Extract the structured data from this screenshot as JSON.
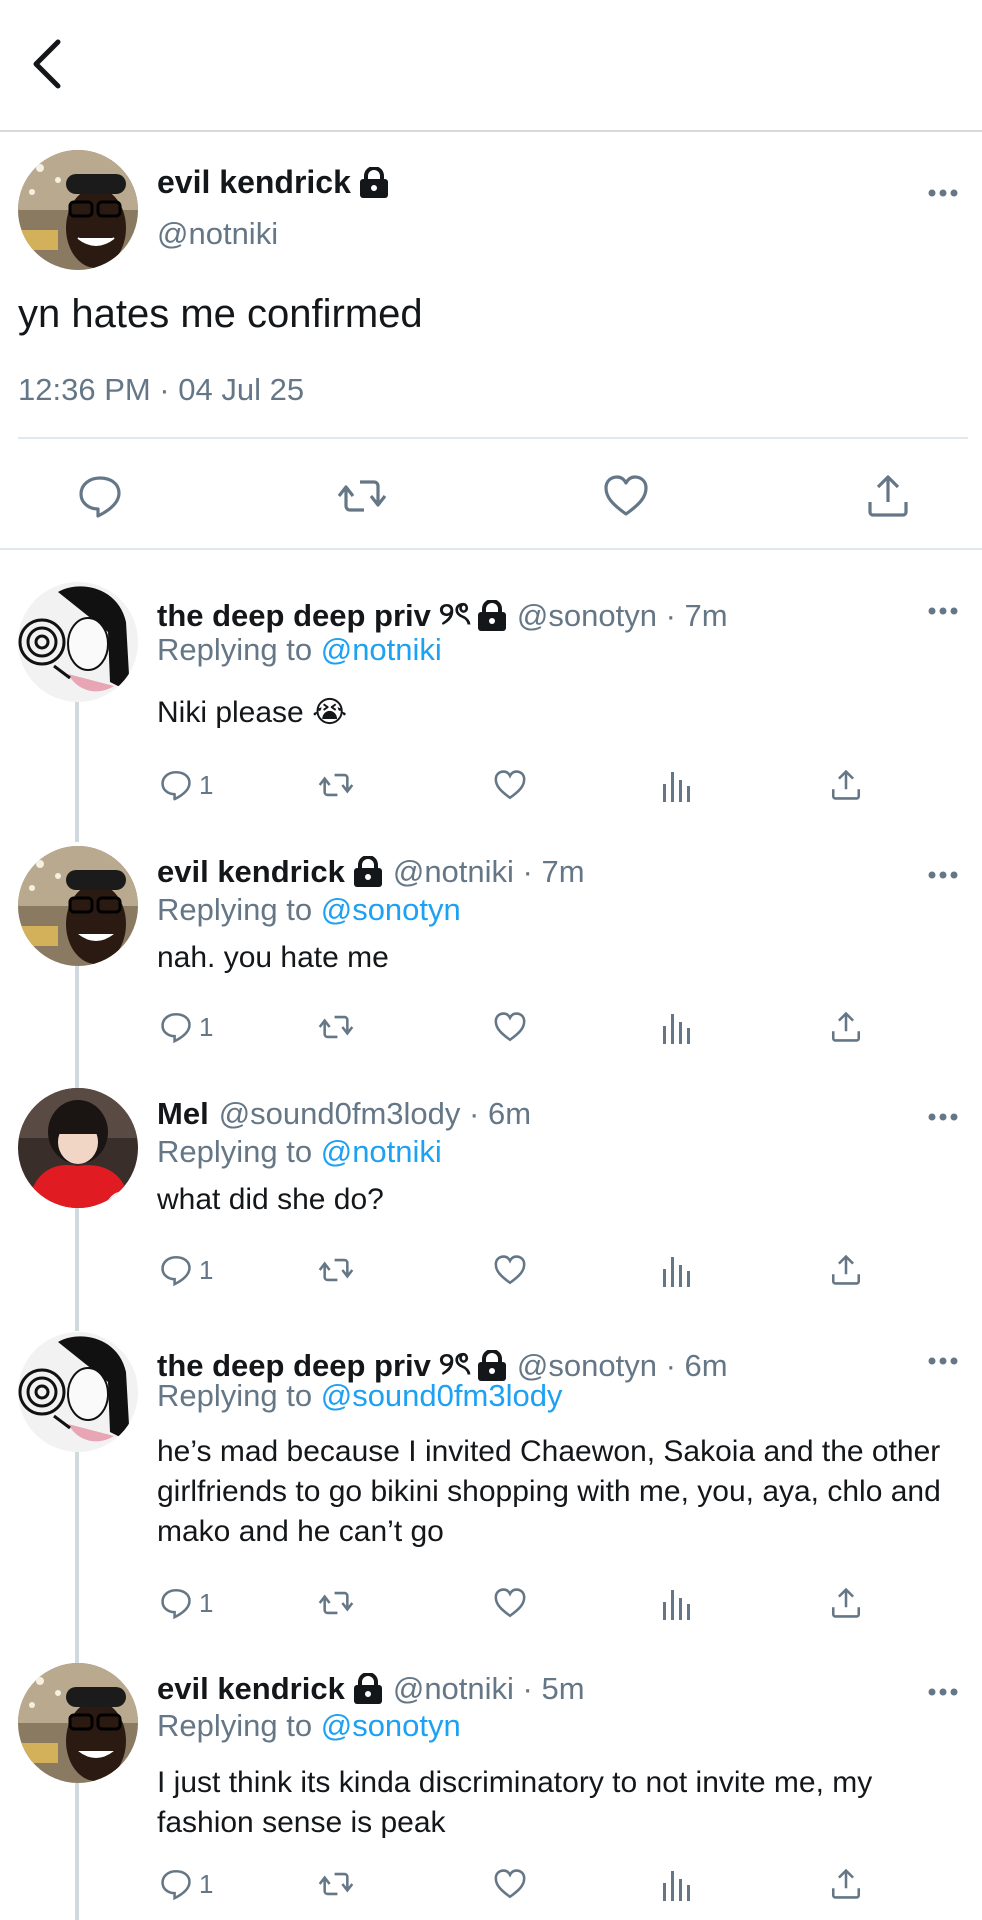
{
  "header": {
    "back_label": "Back"
  },
  "main_tweet": {
    "name": "evil kendrick",
    "handle": "@notniki",
    "text": "yn hates me confirmed",
    "timestamp": "12:36 PM · 04 Jul 25"
  },
  "replies": [
    {
      "name": "the deep deep priv",
      "emoji": "୨ৎ",
      "meta": "@sonotyn · 7m",
      "replying_prefix": "Replying to ",
      "replying_to": "@notniki",
      "text": "Niki please 😭",
      "reply_count": "1"
    },
    {
      "name": "evil kendrick",
      "meta": "@notniki · 7m",
      "replying_prefix": "Replying to ",
      "replying_to": "@sonotyn",
      "text": "nah. you hate me",
      "reply_count": "1"
    },
    {
      "name": "Mel",
      "meta": "@sound0fm3lody · 6m",
      "replying_prefix": "Replying to ",
      "replying_to": "@notniki",
      "text": "what did she do?",
      "reply_count": "1"
    },
    {
      "name": "the deep deep priv",
      "emoji": "୨ৎ",
      "meta": "@sonotyn · 6m",
      "replying_prefix": "Replying to ",
      "replying_to": "@sound0fm3lody",
      "text": "he’s mad because I invited Chaewon, Sakoia and the other girlfriends to go bikini shopping with me, you, aya, chlo and mako and he can’t go",
      "reply_count": "1"
    },
    {
      "name": "evil kendrick",
      "meta": "@notniki · 5m",
      "replying_prefix": "Replying to ",
      "replying_to": "@sonotyn",
      "text": "I just think its kinda discriminatory to not invite me, my fashion sense is peak",
      "reply_count": "1"
    }
  ],
  "colors": {
    "link": "#1da1f2",
    "secondary": "#657786",
    "divider": "#e1e8ed"
  },
  "icons": [
    "back-chevron-icon",
    "lock-icon",
    "more-icon",
    "reply-icon",
    "retweet-icon",
    "like-icon",
    "share-icon",
    "analytics-icon"
  ]
}
